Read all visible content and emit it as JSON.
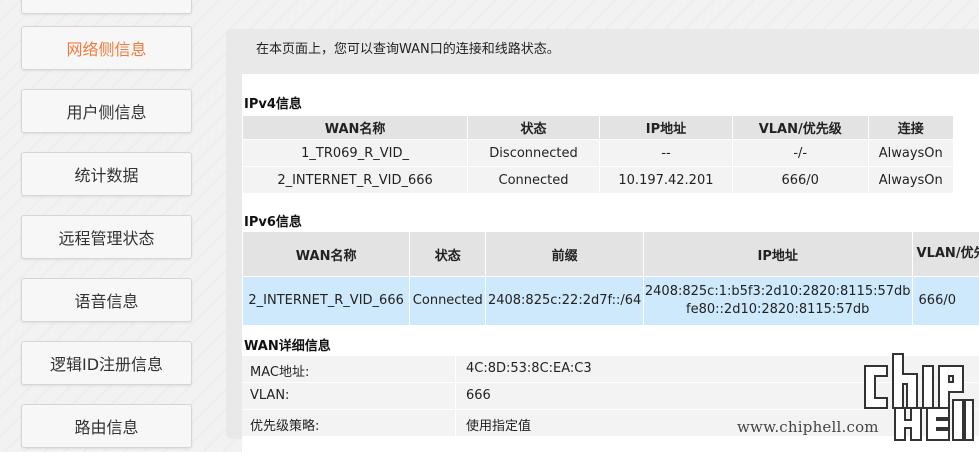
{
  "sidebar": {
    "items": [
      {
        "label": "网络侧信息",
        "active": true
      },
      {
        "label": "用户侧信息",
        "active": false
      },
      {
        "label": "统计数据",
        "active": false
      },
      {
        "label": "远程管理状态",
        "active": false
      },
      {
        "label": "语音信息",
        "active": false
      },
      {
        "label": "逻辑ID注册信息",
        "active": false
      },
      {
        "label": "路由信息",
        "active": false
      }
    ]
  },
  "main": {
    "description": "在本页面上，您可以查询WAN口的连接和线路状态。",
    "ipv4": {
      "title": "IPv4信息",
      "headers": [
        "WAN名称",
        "状态",
        "IP地址",
        "VLAN/优先级",
        "连接"
      ],
      "rows": [
        [
          "1_TR069_R_VID_",
          "Disconnected",
          "--",
          "-/-",
          "AlwaysOn"
        ],
        [
          "2_INTERNET_R_VID_666",
          "Connected",
          "10.197.42.201",
          "666/0",
          "AlwaysOn"
        ]
      ]
    },
    "ipv6": {
      "title": "IPv6信息",
      "headers": [
        "WAN名称",
        "状态",
        "前缀",
        "IP地址",
        "VLAN/优先级"
      ],
      "row": {
        "name": "2_INTERNET_R_VID_666",
        "status": "Connected",
        "prefix": "2408:825c:22:2d7f::/64",
        "ip1": "2408:825c:1:b5f3:2d10:2820:8115:57db",
        "ip2": "fe80::2d10:2820:8115:57db",
        "vlan": "666/0"
      }
    },
    "detail": {
      "title": "WAN详细信息",
      "rows": [
        {
          "key": "MAC地址:",
          "value": "4C:8D:53:8C:EA:C3"
        },
        {
          "key": "VLAN:",
          "value": "666"
        },
        {
          "key": "优先级策略:",
          "value": "使用指定值"
        }
      ]
    }
  },
  "watermark": {
    "text": "www.chiphell.com"
  },
  "colors": {
    "active_nav": "#f07a3c",
    "ipv6_row": "#cde9fb"
  }
}
